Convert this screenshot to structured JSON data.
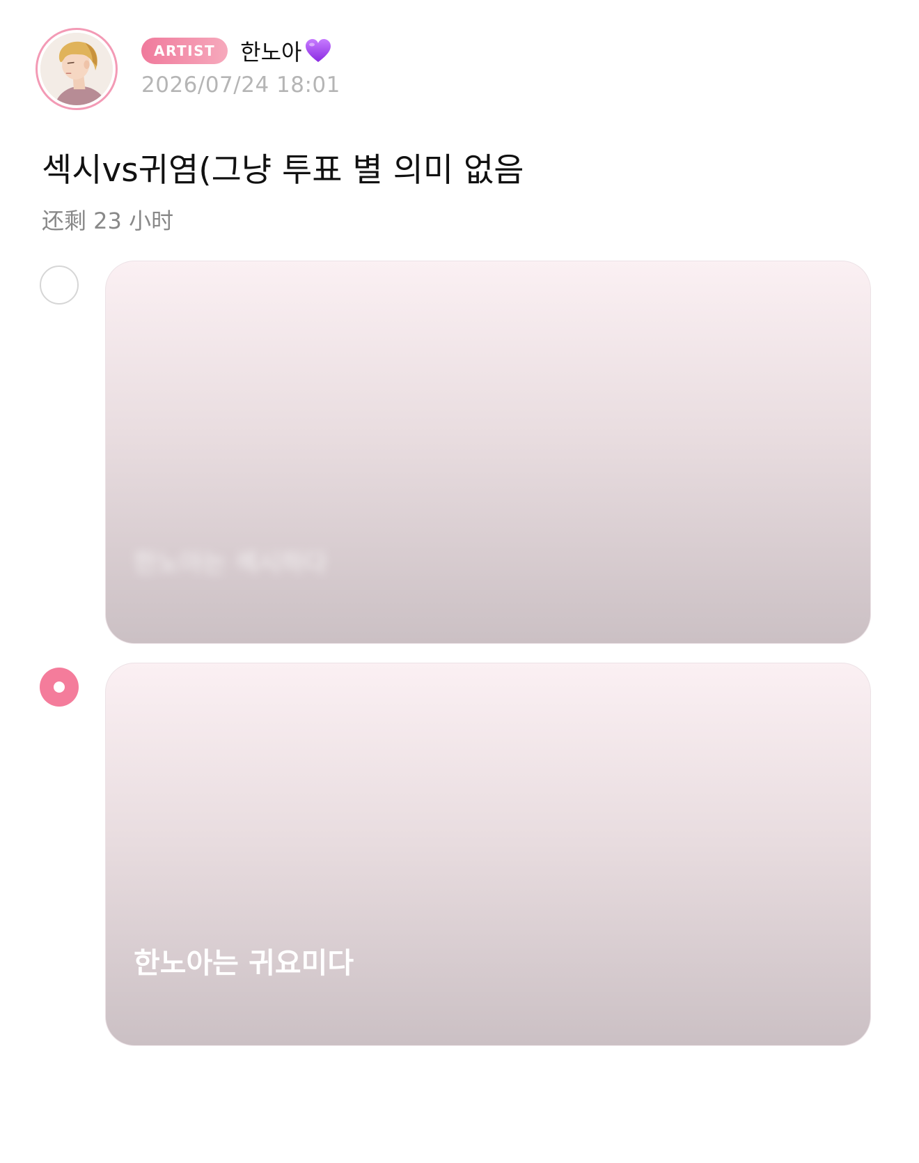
{
  "post": {
    "badge": "ARTIST",
    "author": "한노아",
    "author_emoji": "purple-heart-icon",
    "timestamp": "2026/07/24 18:01",
    "title": "섹시vs귀염(그냥 투표 별 의미 없음",
    "time_remaining": "还剩 23 小时"
  },
  "poll": {
    "options": [
      {
        "label": "한노아는 섹시하다",
        "selected": false,
        "label_blurred": true
      },
      {
        "label": "한노아는 귀요미다",
        "selected": true,
        "label_blurred": false
      }
    ]
  },
  "colors": {
    "accent": "#f47c9b",
    "badge_start": "#f07a9c",
    "badge_end": "#f6a9bc",
    "timestamp": "#b5b5b5",
    "subtle_text": "#888888"
  }
}
